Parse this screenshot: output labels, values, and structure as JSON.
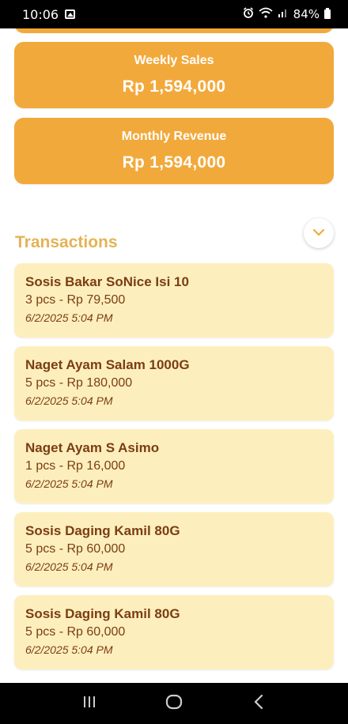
{
  "status_bar": {
    "time": "10:06",
    "battery": "84%"
  },
  "summary": {
    "weekly_label": "Weekly Sales",
    "weekly_value": "Rp 1,594,000",
    "monthly_label": "Monthly Revenue",
    "monthly_value": "Rp 1,594,000"
  },
  "transactions": {
    "title": "Transactions",
    "items": [
      {
        "name": "Sosis Bakar SoNice Isi 10",
        "detail": "3 pcs - Rp 79,500",
        "time": "6/2/2025 5:04 PM"
      },
      {
        "name": "Naget Ayam Salam 1000G",
        "detail": "5 pcs - Rp 180,000",
        "time": "6/2/2025 5:04 PM"
      },
      {
        "name": "Naget Ayam S Asimo",
        "detail": "1 pcs - Rp 16,000",
        "time": "6/2/2025 5:04 PM"
      },
      {
        "name": "Sosis Daging Kamil 80G",
        "detail": "5 pcs - Rp 60,000",
        "time": "6/2/2025 5:04 PM"
      },
      {
        "name": "Sosis Daging Kamil 80G",
        "detail": "5 pcs - Rp 60,000",
        "time": "6/2/2025 5:04 PM"
      }
    ]
  },
  "colors": {
    "accent": "#f2a93b",
    "title": "#e4b356",
    "card_bg": "#fdefbd",
    "card_text": "#7b3d14"
  },
  "icons": {
    "gallery": "image-icon",
    "alarm": "alarm-icon",
    "wifi": "wifi-icon",
    "signal": "signal-icon",
    "battery": "battery-icon",
    "collapse": "chevron-down-icon",
    "recents": "recents-icon",
    "home": "home-icon",
    "back": "back-icon"
  }
}
